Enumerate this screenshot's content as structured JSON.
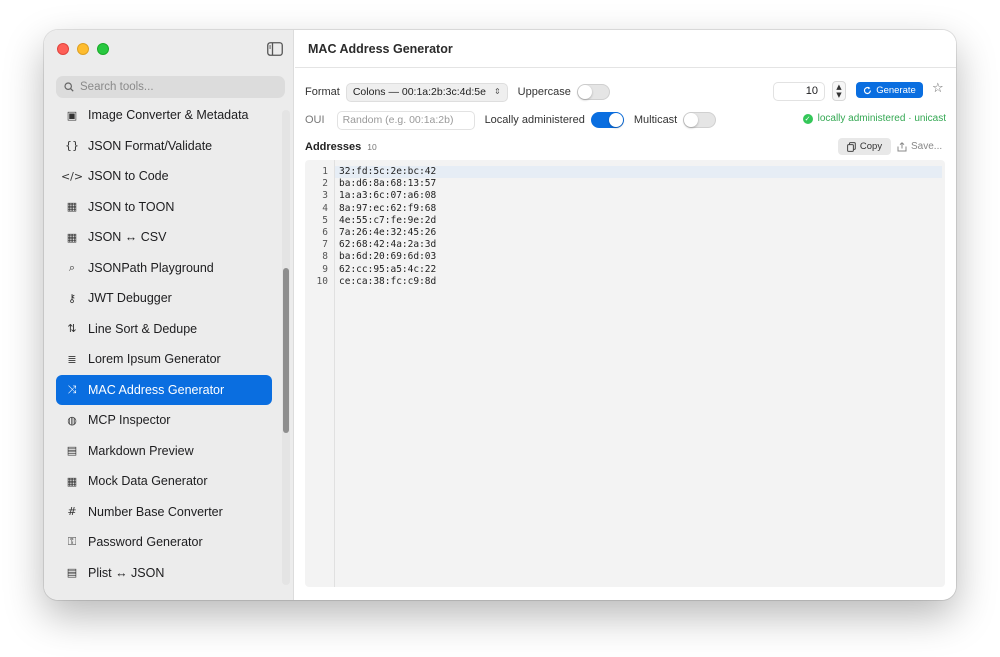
{
  "sidebar": {
    "search_placeholder": "Search tools...",
    "items": [
      {
        "icon": "image-icon",
        "glyph": "▣",
        "label": "Image Converter & Metadata"
      },
      {
        "icon": "braces-icon",
        "glyph": "{}",
        "label": "JSON Format/Validate"
      },
      {
        "icon": "code-icon",
        "glyph": "</>",
        "label": "JSON to Code"
      },
      {
        "icon": "table-icon",
        "glyph": "▦",
        "label": "JSON to TOON"
      },
      {
        "icon": "table-icon",
        "glyph": "▦",
        "label": "JSON ↔ CSV"
      },
      {
        "icon": "magnifier-icon",
        "glyph": "⌕",
        "label": "JSONPath Playground"
      },
      {
        "icon": "key-icon",
        "glyph": "⚷",
        "label": "JWT Debugger"
      },
      {
        "icon": "sort-arrows-icon",
        "glyph": "⇅",
        "label": "Line Sort & Dedupe"
      },
      {
        "icon": "text-lines-icon",
        "glyph": "≣",
        "label": "Lorem Ipsum Generator"
      },
      {
        "icon": "shuffle-icon",
        "glyph": "⤨",
        "label": "MAC Address Generator",
        "selected": true
      },
      {
        "icon": "globe-icon",
        "glyph": "◍",
        "label": "MCP Inspector"
      },
      {
        "icon": "document-icon",
        "glyph": "▤",
        "label": "Markdown Preview"
      },
      {
        "icon": "table-icon",
        "glyph": "▦",
        "label": "Mock Data Generator"
      },
      {
        "icon": "hash-icon",
        "glyph": "#",
        "label": "Number Base Converter"
      },
      {
        "icon": "lock-icon",
        "glyph": "⚿",
        "label": "Password Generator"
      },
      {
        "icon": "list-icon",
        "glyph": "▤",
        "label": "Plist ↔ JSON"
      }
    ]
  },
  "main": {
    "title": "MAC Address Generator",
    "format_label": "Format",
    "format_value": "Colons — 00:1a:2b:3c:4d:5e",
    "uppercase_label": "Uppercase",
    "count_value": "10",
    "generate_label": "Generate",
    "oui_label": "OUI",
    "oui_placeholder": "Random (e.g. 00:1a:2b)",
    "locally_admin_label": "Locally administered",
    "multicast_label": "Multicast",
    "status_text": "locally administered · unicast",
    "addresses_label": "Addresses",
    "addresses_count": "10",
    "copy_label": "Copy",
    "save_label": "Save...",
    "line_numbers": [
      "1",
      "2",
      "3",
      "4",
      "5",
      "6",
      "7",
      "8",
      "9",
      "10"
    ],
    "addresses": [
      "32:fd:5c:2e:bc:42",
      "ba:d6:8a:68:13:57",
      "1a:a3:6c:07:a6:08",
      "8a:97:ec:62:f9:68",
      "4e:55:c7:fe:9e:2d",
      "7a:26:4e:32:45:26",
      "62:68:42:4a:2a:3d",
      "ba:6d:20:69:6d:03",
      "62:cc:95:a5:4c:22",
      "ce:ca:38:fc:c9:8d"
    ]
  },
  "colors": {
    "accent": "#0a6ee0",
    "success": "#34c759"
  }
}
